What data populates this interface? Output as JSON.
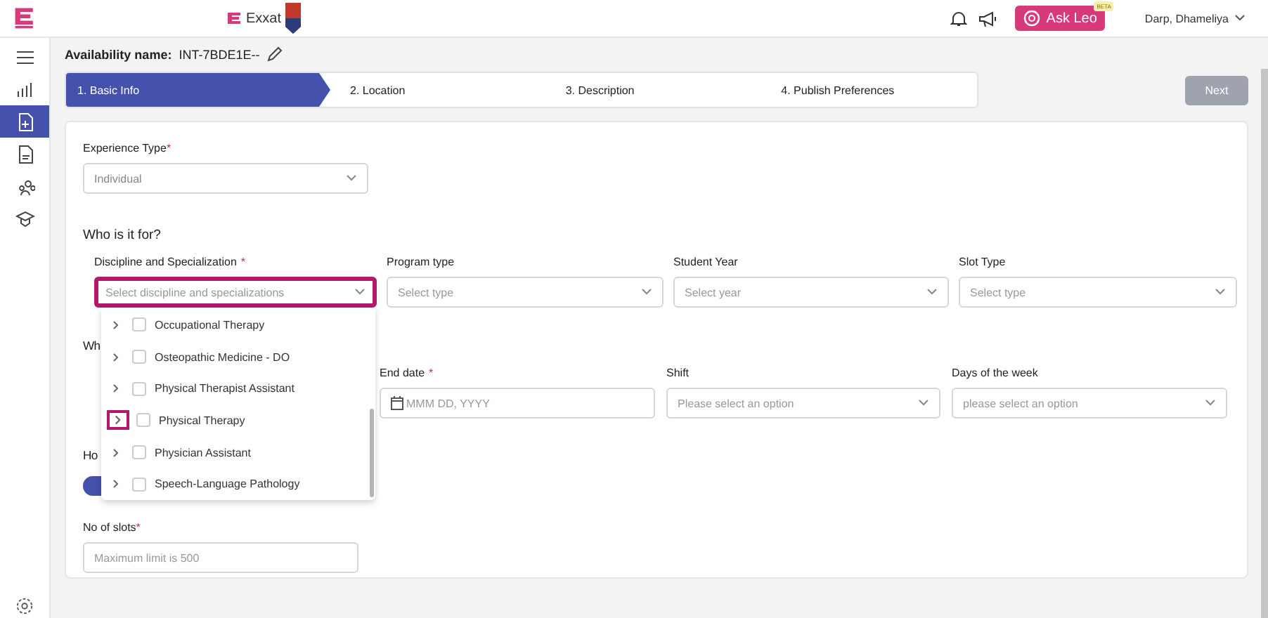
{
  "topbar": {
    "brand": "Exxat",
    "ask_button": "Ask Leo",
    "beta_badge": "BETA",
    "user": "Darp, Dhameliya"
  },
  "sidebar": {
    "items": [
      {
        "kind": "menu",
        "selected": false
      },
      {
        "kind": "chart",
        "selected": false
      },
      {
        "kind": "file-plus",
        "selected": true
      },
      {
        "kind": "file",
        "selected": false
      },
      {
        "kind": "people",
        "selected": false
      },
      {
        "kind": "cap",
        "selected": false
      }
    ]
  },
  "availability": {
    "label": "Availability name:",
    "value": "INT-7BDE1E--"
  },
  "steps": [
    {
      "label": "1.  Basic Info",
      "selected": true
    },
    {
      "label": "2.  Location",
      "selected": false
    },
    {
      "label": "3.  Description",
      "selected": false
    },
    {
      "label": "4.  Publish Preferences",
      "selected": false
    }
  ],
  "next_button": {
    "label": "Next",
    "disabled": true
  },
  "experience_type": {
    "label": "Experience Type",
    "required_mark": "*",
    "value": "Individual"
  },
  "who_heading": "Who is it for?",
  "who_fields": [
    {
      "label": "Discipline and Specialization",
      "required_mark": "*",
      "placeholder": "Select discipline and specializations",
      "highlighted": true
    },
    {
      "label": "Program type",
      "placeholder": "Select type",
      "highlighted": false
    },
    {
      "label": "Student Year",
      "placeholder": "Select year",
      "highlighted": false
    },
    {
      "label": "Slot Type",
      "placeholder": "Select type",
      "highlighted": false
    }
  ],
  "when_heading": "Wh",
  "when_fields": [
    {
      "kind": "date",
      "label": "End date",
      "required_mark": "*",
      "placeholder": "MMM DD, YYYY"
    },
    {
      "kind": "select",
      "label": "Shift",
      "placeholder": "Please select an option"
    },
    {
      "kind": "select",
      "label": "Days of the week",
      "placeholder": "please select an option"
    }
  ],
  "how_heading": "Ho",
  "toggle": {
    "on": true
  },
  "slots": {
    "label": "No of slots",
    "required_mark": "*",
    "placeholder": "Maximum limit is 500"
  },
  "dropdown": {
    "items": [
      {
        "label": "Occupational Therapy",
        "checked": false,
        "highlighted": false
      },
      {
        "label": "Osteopathic Medicine - DO",
        "checked": false,
        "highlighted": false
      },
      {
        "label": "Physical Therapist Assistant",
        "checked": false,
        "highlighted": false
      },
      {
        "label": "Physical Therapy",
        "checked": false,
        "highlighted": true
      },
      {
        "label": "Physician Assistant",
        "checked": false,
        "highlighted": false
      },
      {
        "label": "Speech-Language Pathology",
        "checked": false,
        "highlighted": false
      }
    ]
  }
}
